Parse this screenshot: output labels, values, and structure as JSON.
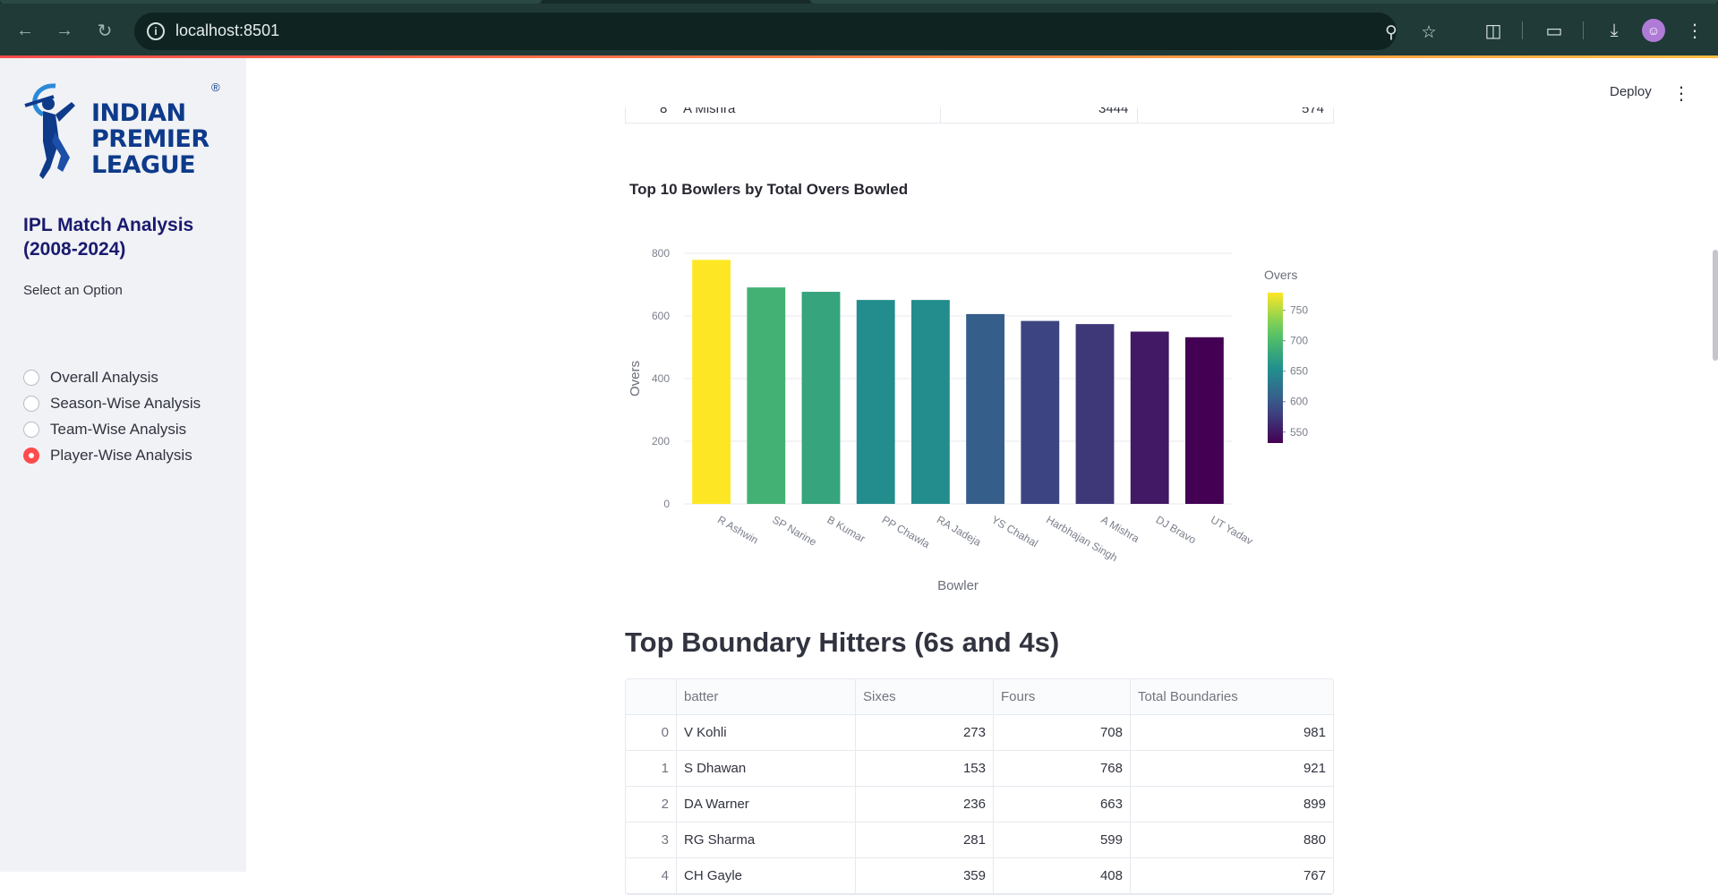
{
  "browser": {
    "url": "localhost:8501",
    "icons": [
      "back-arrow-icon",
      "forward-arrow-icon",
      "reload-icon",
      "zoom-icon",
      "bookmark-star-icon",
      "extensions-icon",
      "cast-icon",
      "download-icon",
      "profile-avatar",
      "more-vert-icon"
    ]
  },
  "sidebar": {
    "logo_lines": [
      "INDIAN",
      "PREMIER",
      "LEAGUE"
    ],
    "logo_mark": "®",
    "title": "IPL Match Analysis (2008-2024)",
    "select_label": "Select an Option",
    "options": [
      {
        "label": "Overall Analysis",
        "selected": false
      },
      {
        "label": "Season-Wise Analysis",
        "selected": false
      },
      {
        "label": "Team-Wise Analysis",
        "selected": false
      },
      {
        "label": "Player-Wise Analysis",
        "selected": true
      }
    ]
  },
  "header": {
    "deploy_label": "Deploy",
    "menu_glyph": "⋮"
  },
  "partial_table_row": {
    "index": "8",
    "name": "A Mishra",
    "value1": "3444",
    "value2": "574"
  },
  "chart_data": {
    "type": "bar",
    "title": "Top 10 Bowlers by Total Overs Bowled",
    "xlabel": "Bowler",
    "ylabel": "Overs",
    "categories": [
      "R Ashwin",
      "SP Narine",
      "B Kumar",
      "PP Chawla",
      "RA Jadeja",
      "YS Chahal",
      "Harbhajan Singh",
      "A Mishra",
      "DJ Bravo",
      "UT Yadav"
    ],
    "values": [
      779,
      691,
      677,
      651,
      651,
      606,
      584,
      574,
      550,
      532
    ],
    "ylim": [
      0,
      800
    ],
    "yticks": [
      0,
      200,
      400,
      600,
      800
    ],
    "colorbar": {
      "title": "Overs",
      "ticks": [
        750,
        700,
        650,
        600,
        550
      ],
      "range": [
        532,
        779
      ],
      "colorscale": "viridis"
    },
    "grid": true
  },
  "boundary_section": {
    "heading": "Top Boundary Hitters (6s and 4s)",
    "columns": [
      "",
      "batter",
      "Sixes",
      "Fours",
      "Total Boundaries"
    ],
    "rows": [
      {
        "index": "0",
        "batter": "V Kohli",
        "sixes": "273",
        "fours": "708",
        "total": "981"
      },
      {
        "index": "1",
        "batter": "S Dhawan",
        "sixes": "153",
        "fours": "768",
        "total": "921"
      },
      {
        "index": "2",
        "batter": "DA Warner",
        "sixes": "236",
        "fours": "663",
        "total": "899"
      },
      {
        "index": "3",
        "batter": "RG Sharma",
        "sixes": "281",
        "fours": "599",
        "total": "880"
      },
      {
        "index": "4",
        "batter": "CH Gayle",
        "sixes": "359",
        "fours": "408",
        "total": "767"
      }
    ]
  }
}
